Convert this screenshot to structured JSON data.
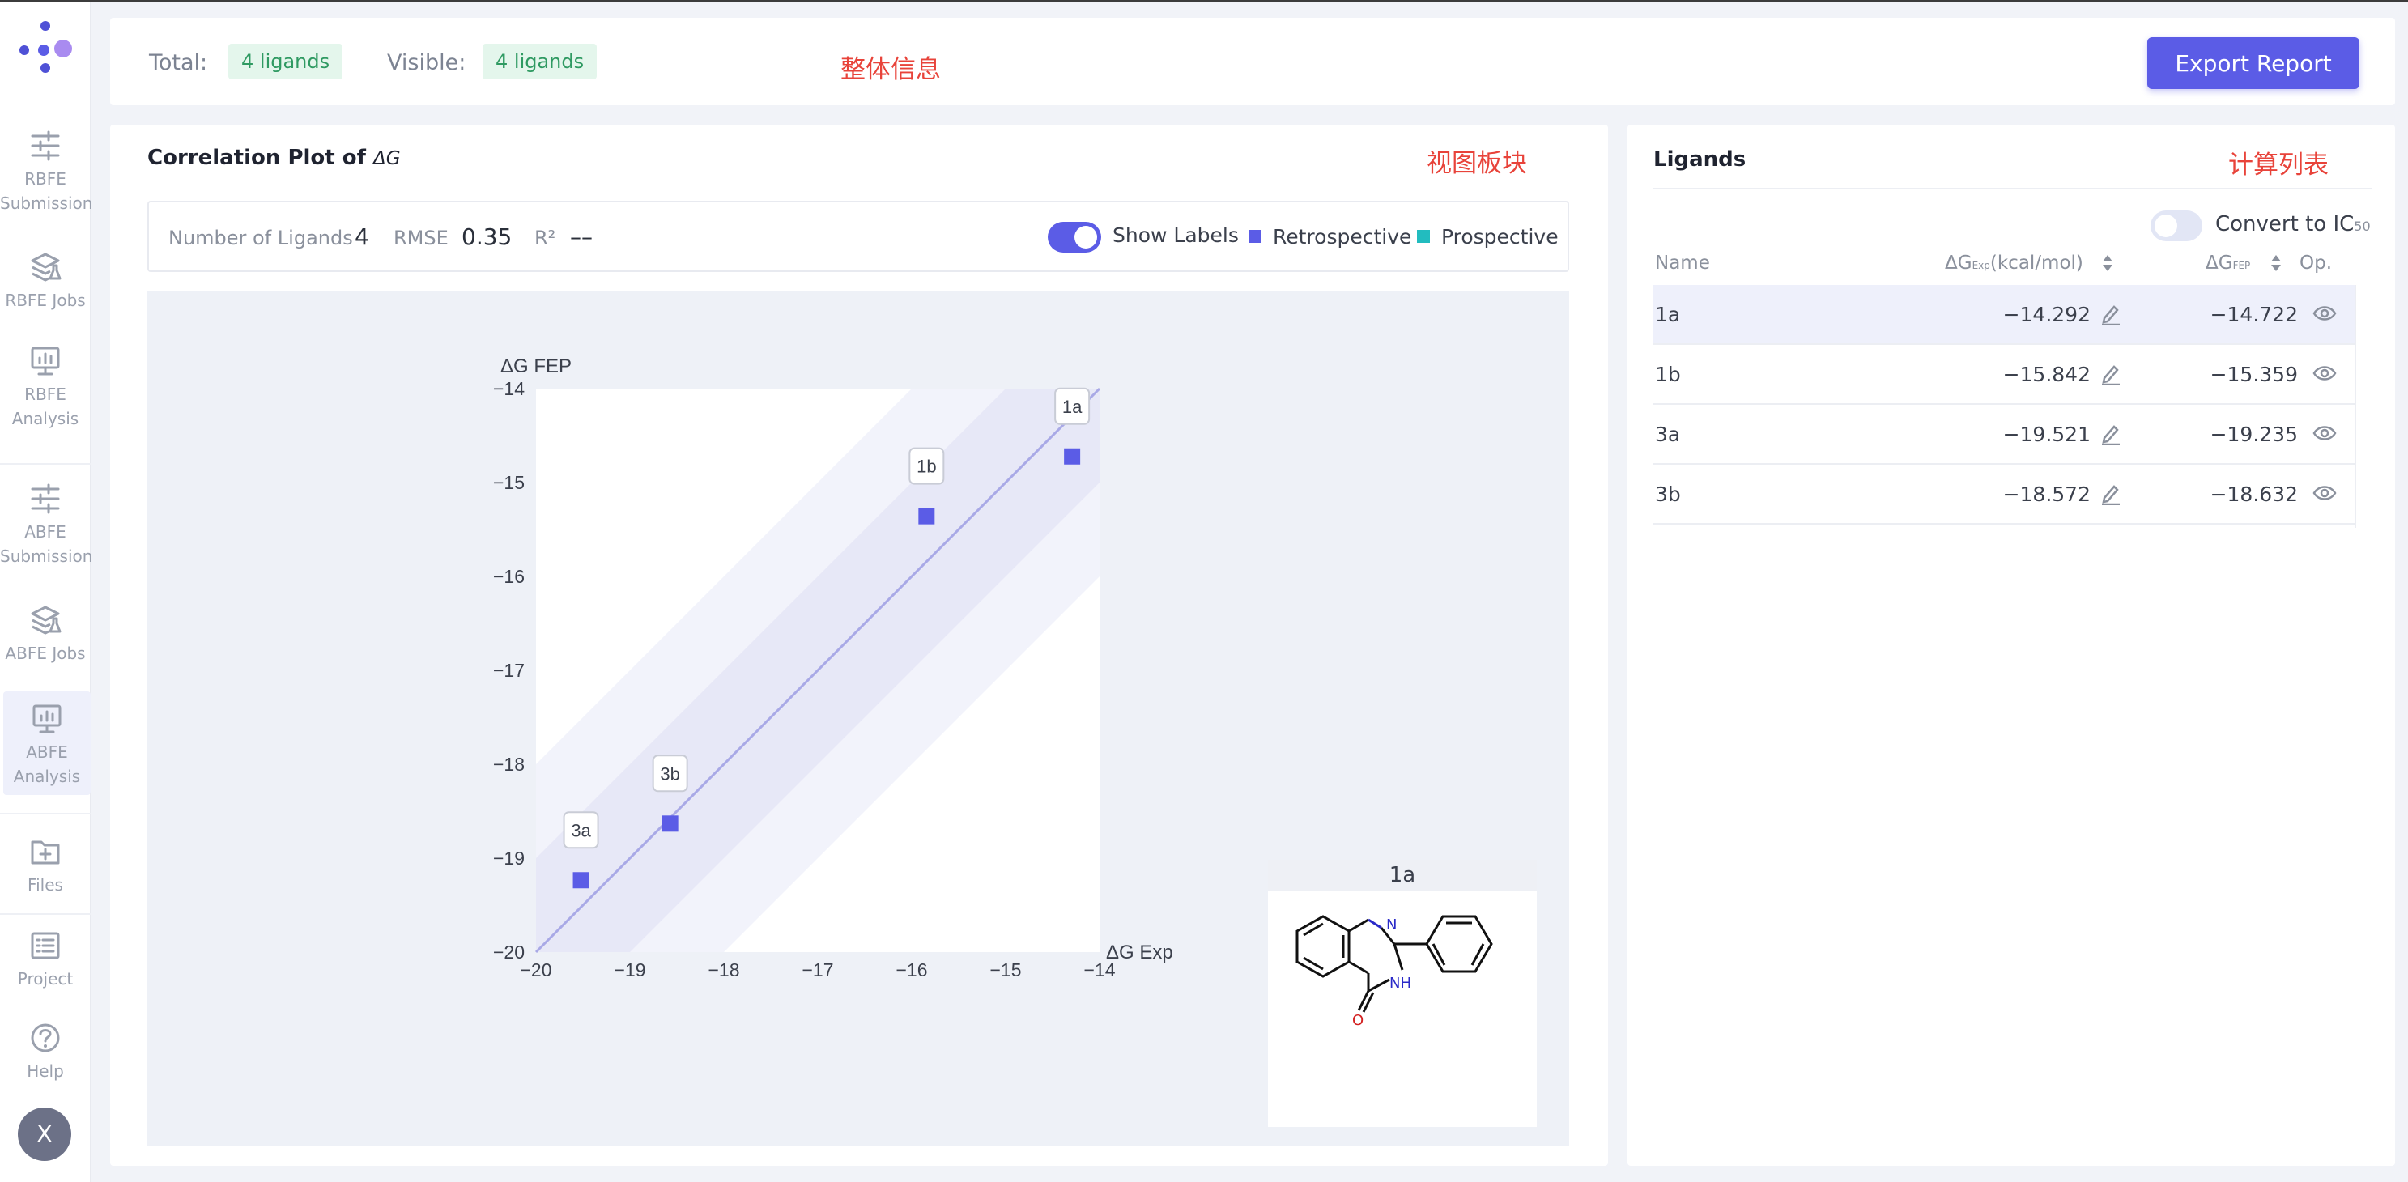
{
  "sidebar": {
    "items": [
      {
        "label_line1": "RBFE",
        "label_line2": "Submission",
        "icon": "sliders-icon"
      },
      {
        "label_line1": "RBFE Jobs",
        "label_line2": "",
        "icon": "flask-stack-icon"
      },
      {
        "label_line1": "RBFE",
        "label_line2": "Analysis",
        "icon": "monitor-chart-icon"
      },
      {
        "label_line1": "ABFE",
        "label_line2": "Submission",
        "icon": "sliders-icon"
      },
      {
        "label_line1": "ABFE Jobs",
        "label_line2": "",
        "icon": "flask-stack-icon"
      },
      {
        "label_line1": "ABFE",
        "label_line2": "Analysis",
        "icon": "monitor-chart-icon"
      },
      {
        "label_line1": "Files",
        "label_line2": "",
        "icon": "folder-add-icon"
      },
      {
        "label_line1": "Project",
        "label_line2": "",
        "icon": "list-icon"
      },
      {
        "label_line1": "Help",
        "label_line2": "",
        "icon": "help-circle-icon"
      }
    ],
    "active_index": 5,
    "avatar_initial": "X"
  },
  "header": {
    "total_label": "Total:",
    "total_badge": "4 ligands",
    "visible_label": "Visible:",
    "visible_badge": "4 ligands",
    "annotation": "整体信息",
    "export_button": "Export Report"
  },
  "plot_panel": {
    "title": "Correlation Plot of",
    "title_symbol": "ΔG",
    "annotation": "视图板块",
    "stats": {
      "num_ligands_label": "Number of Ligands",
      "num_ligands_value": "4",
      "rmse_label": "RMSE",
      "rmse_value": "0.35",
      "r2_label": "R²",
      "r2_value": "––"
    },
    "show_labels_label": "Show Labels",
    "show_labels_on": true,
    "legend": [
      {
        "name": "Retrospective",
        "color": "#5b5ce6"
      },
      {
        "name": "Prospective",
        "color": "#22bcbf"
      }
    ],
    "structure_title": "1a"
  },
  "chart_data": {
    "type": "scatter",
    "xlabel": "ΔG Exp",
    "ylabel": "ΔG FEP",
    "xlim": [
      -20,
      -14
    ],
    "ylim": [
      -20,
      -14
    ],
    "xticks": [
      "−20",
      "−19",
      "−18",
      "−17",
      "−16",
      "−15",
      "−14"
    ],
    "yticks": [
      "−20",
      "−19",
      "−18",
      "−17",
      "−16",
      "−15",
      "−14"
    ],
    "diagonal": true,
    "bands": [
      1,
      2
    ],
    "series": [
      {
        "name": "Retrospective",
        "color": "#5b5ce6",
        "points": [
          {
            "label": "1a",
            "x": -14.292,
            "y": -14.722
          },
          {
            "label": "1b",
            "x": -15.842,
            "y": -15.359
          },
          {
            "label": "3a",
            "x": -19.521,
            "y": -19.235
          },
          {
            "label": "3b",
            "x": -18.572,
            "y": -18.632
          }
        ]
      }
    ]
  },
  "ligands_panel": {
    "title": "Ligands",
    "annotation": "计算列表",
    "convert_label": "Convert to IC",
    "convert_sub": "50",
    "columns": {
      "name": "Name",
      "exp": "ΔG",
      "exp_sub": "Exp",
      "exp_unit": "(kcal/mol)",
      "fep": "ΔG",
      "fep_sub": "FEP",
      "op": "Op."
    },
    "rows": [
      {
        "name": "1a",
        "exp": "−14.292",
        "fep": "−14.722"
      },
      {
        "name": "1b",
        "exp": "−15.842",
        "fep": "−15.359"
      },
      {
        "name": "3a",
        "exp": "−19.521",
        "fep": "−19.235"
      },
      {
        "name": "3b",
        "exp": "−18.572",
        "fep": "−18.632"
      }
    ],
    "selected_index": 0
  },
  "colors": {
    "accent": "#5b5ce6",
    "annotation_red": "#e8433a",
    "badge_green": "#2f9a62",
    "prospective_teal": "#22bcbf"
  }
}
